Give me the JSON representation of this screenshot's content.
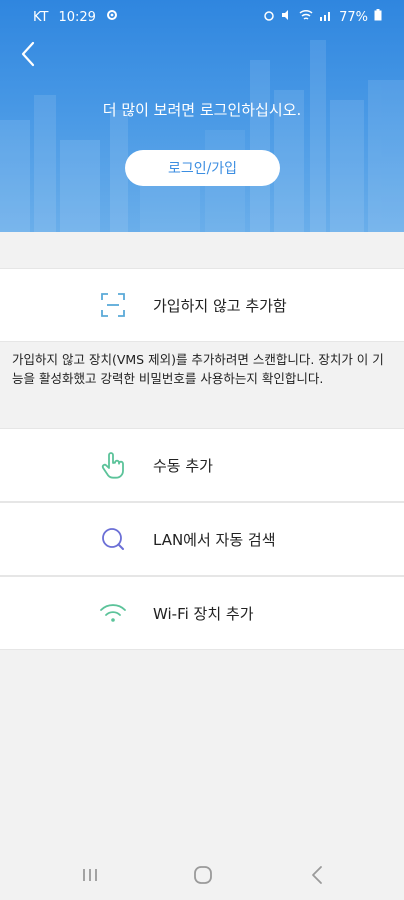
{
  "status_bar": {
    "carrier": "KT",
    "time": "10:29",
    "battery": "77%"
  },
  "header": {
    "prompt": "더 많이 보려면 로그인하십시오.",
    "login_button": "로그인/가입"
  },
  "actions": [
    {
      "label": "가입하지 않고 추가함",
      "icon": "scan-icon"
    },
    {
      "label": "수동 추가",
      "icon": "hand-pointer-icon"
    },
    {
      "label": "LAN에서 자동 검색",
      "icon": "search-icon"
    },
    {
      "label": "Wi-Fi 장치 추가",
      "icon": "wifi-icon"
    }
  ],
  "description": "가입하지 않고 장치(VMS 제외)를 추가하려면 스캔합니다. 장치가 이 기능을 활성화했고 강력한 비밀번호를 사용하는지 확인합니다.",
  "colors": {
    "header_blue": "#2f86df",
    "icon_blue": "#5aa9d8",
    "icon_green": "#5cc39a",
    "icon_purple": "#6b6fd6"
  }
}
